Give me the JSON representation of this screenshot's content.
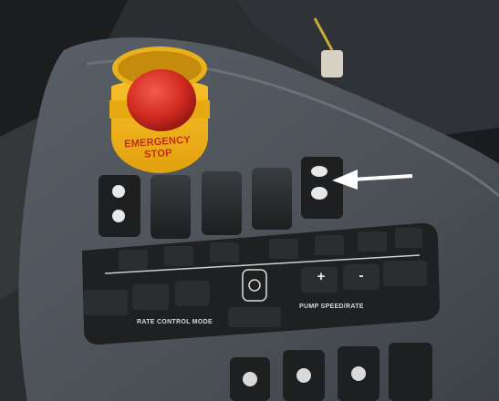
{
  "emergency_stop": {
    "line1": "EMERGENCY",
    "line2": "STOP"
  },
  "control_panel": {
    "left_label": "RATE CONTROL MODE",
    "right_label": "PUMP SPEED/RATE",
    "plus_key": "+",
    "minus_key": "-"
  },
  "annotation": {
    "icon": "white-arrow-icon"
  }
}
